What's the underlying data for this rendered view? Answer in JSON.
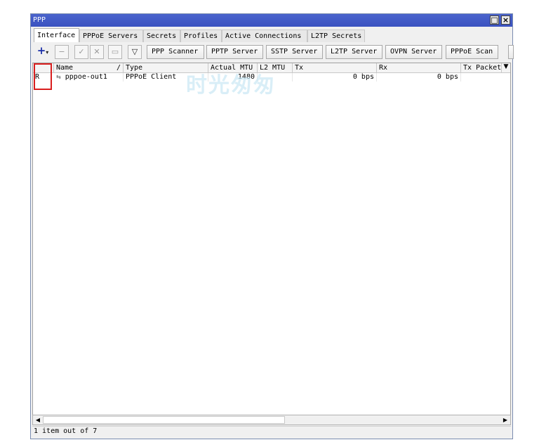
{
  "window": {
    "title": "PPP"
  },
  "tabs": [
    "Interface",
    "PPPoE Servers",
    "Secrets",
    "Profiles",
    "Active Connections",
    "L2TP Secrets"
  ],
  "toolbar": {
    "buttons": [
      "PPP Scanner",
      "PPTP Server",
      "SSTP Server",
      "L2TP Server",
      "OVPN Server",
      "PPPoE Scan"
    ],
    "icons": [
      "add-icon",
      "remove-icon",
      "enable-icon",
      "disable-icon",
      "comment-icon",
      "filter-icon"
    ]
  },
  "table": {
    "columns": [
      "Name",
      "Type",
      "Actual MTU",
      "L2 MTU",
      "Tx",
      "Rx",
      "Tx Packet"
    ],
    "sort_indicator": "/",
    "rows": [
      {
        "flag": "R",
        "name": "pppoe-out1",
        "type": "PPPoE Client",
        "actual_mtu": "1480",
        "l2_mtu": "",
        "tx": "0 bps",
        "rx": "0 bps",
        "tx_packet": ""
      }
    ]
  },
  "watermark": "时光匆匆",
  "status": "1 item out of 7",
  "colors": {
    "titlebar": "#3a52c0",
    "highlight": "#d91e1e",
    "add": "#1a2ea8"
  }
}
